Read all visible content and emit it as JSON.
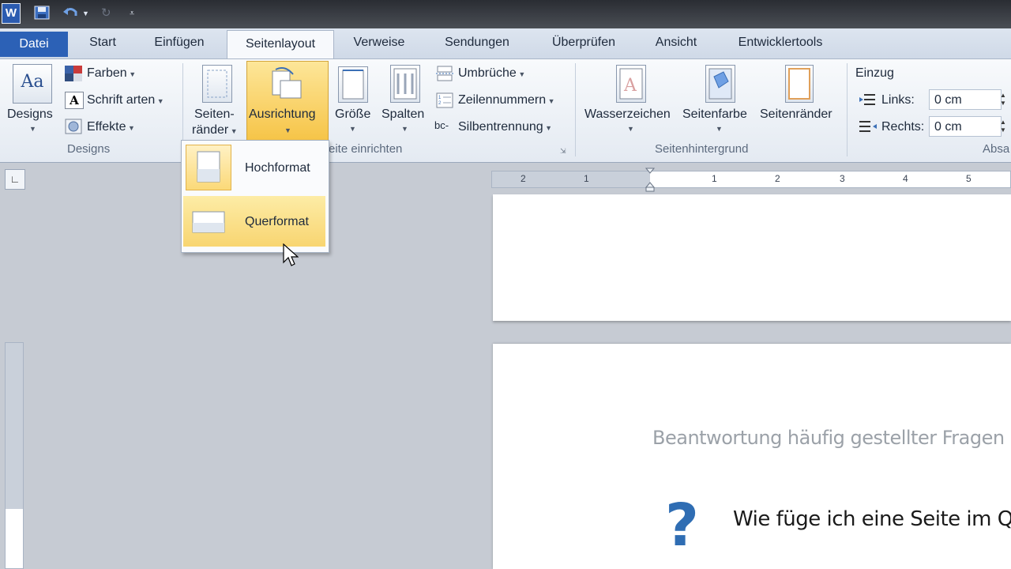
{
  "tabs": {
    "datei": "Datei",
    "start": "Start",
    "einfuegen": "Einfügen",
    "seitenlayout": "Seitenlayout",
    "verweise": "Verweise",
    "sendungen": "Sendungen",
    "ueberpruefen": "Überprüfen",
    "ansicht": "Ansicht",
    "entwicklertools": "Entwicklertools"
  },
  "ribbon": {
    "designs": {
      "designs_label": "Designs",
      "farben": "Farben",
      "schriftarten": "Schrift arten",
      "effekte": "Effekte",
      "group_label": "Designs"
    },
    "seite_einrichten": {
      "seitenraender_1": "Seiten-",
      "seitenraender_2": "ränder",
      "ausrichtung": "Ausrichtung",
      "groesse": "Größe",
      "spalten": "Spalten",
      "umbrueche": "Umbrüche",
      "zeilennummern": "Zeilennummern",
      "silbentrennung": "Silbentrennung",
      "group_label_partial": "eite einrichten"
    },
    "seitenhintergrund": {
      "wasserzeichen": "Wasserzeichen",
      "seitenfarbe": "Seitenfarbe",
      "seitenraender": "Seitenränder",
      "group_label": "Seitenhintergrund"
    },
    "absatz": {
      "einzug": "Einzug",
      "links_label": "Links:",
      "links_value": "0 cm",
      "rechts_label": "Rechts:",
      "rechts_value": "0 cm",
      "group_label_partial": "Absa"
    }
  },
  "dropdown": {
    "hochformat": "Hochformat",
    "querformat": "Querformat"
  },
  "ruler": {
    "ticks": [
      "2",
      "1",
      "1",
      "2",
      "3",
      "4",
      "5"
    ]
  },
  "document": {
    "subtitle": "Beantwortung häufig gestellter  Fragen I",
    "question": "Wie füge ich eine Seite im Q"
  },
  "colors": {
    "datei_tab": "#2c61b6",
    "highlight": "#f6c447",
    "question_mark": "#2f6db3"
  }
}
